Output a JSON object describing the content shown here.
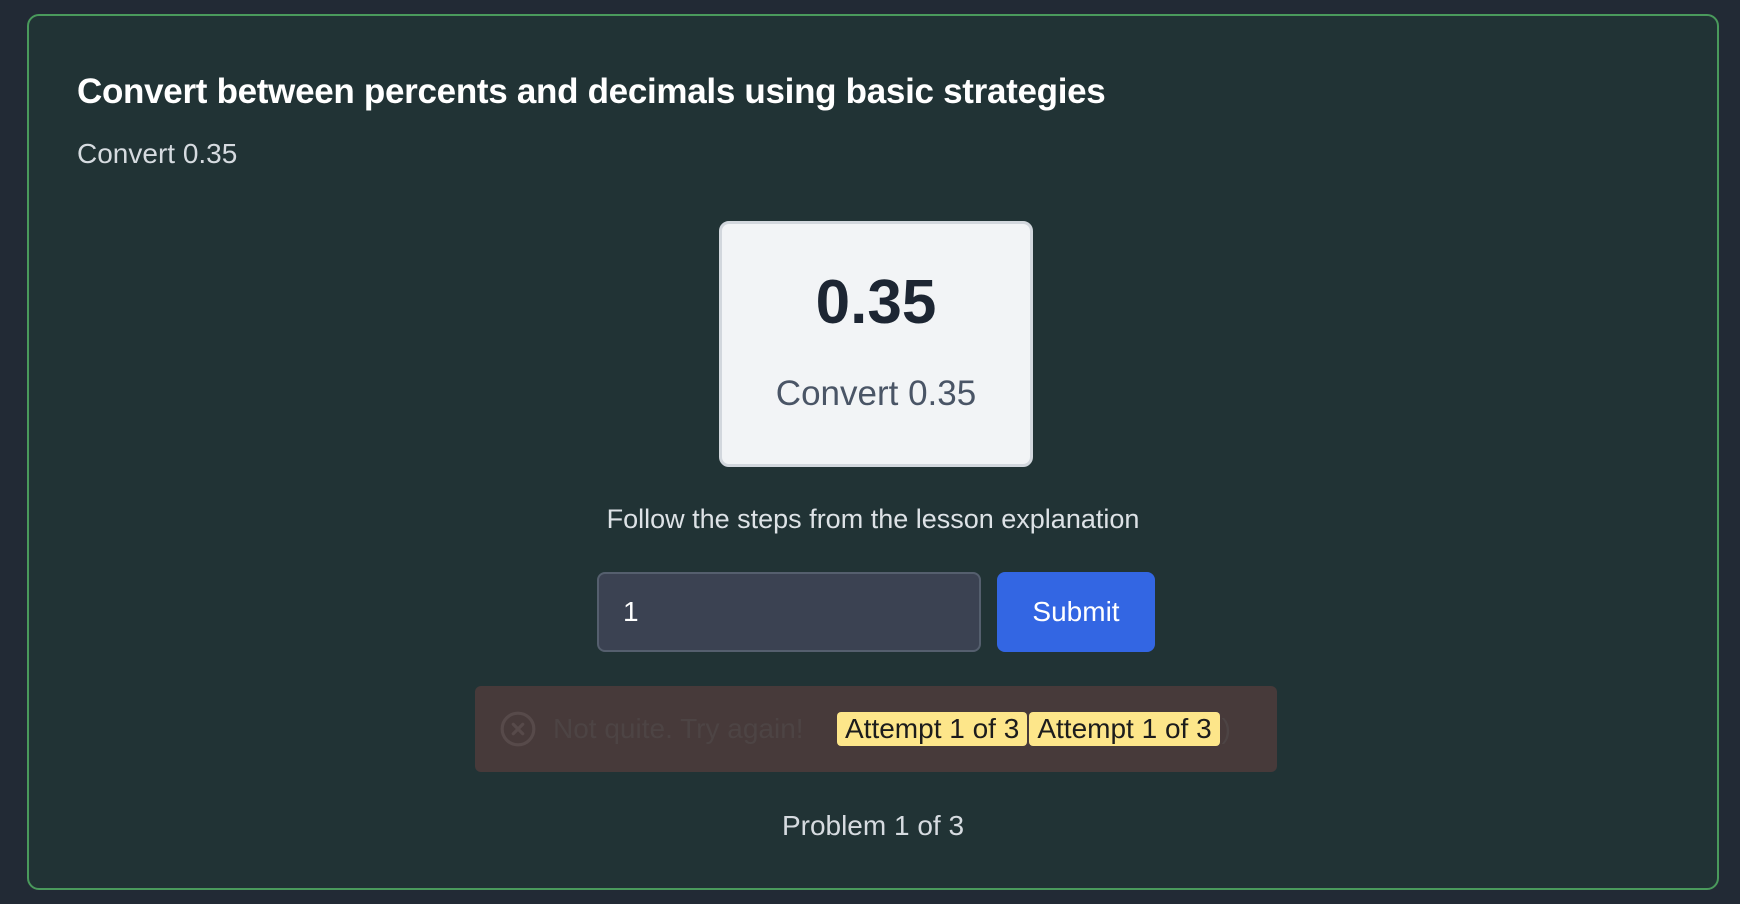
{
  "lesson": {
    "title": "Convert between percents and decimals using basic strategies",
    "subtitle": "Convert 0.35"
  },
  "problem": {
    "value": "0.35",
    "prompt": "Convert 0.35"
  },
  "instructions": "Follow the steps from the lesson explanation",
  "answer": {
    "value": "1",
    "placeholder": ""
  },
  "submit": {
    "label": "Submit"
  },
  "feedback": {
    "icon": "x-circle-icon",
    "message": "Not quite. Try again!",
    "badges": [
      "Attempt 1 of 3",
      "Attempt 1 of 3"
    ],
    "trailing": ")",
    "colors": {
      "background": "#473a3a",
      "badge": "#fde68a"
    }
  },
  "progress": "Problem 1 of 3",
  "colors": {
    "page_background": "#222a35",
    "card_background": "#213335",
    "card_border": "#4a9a5c",
    "accent": "#3366e3"
  }
}
